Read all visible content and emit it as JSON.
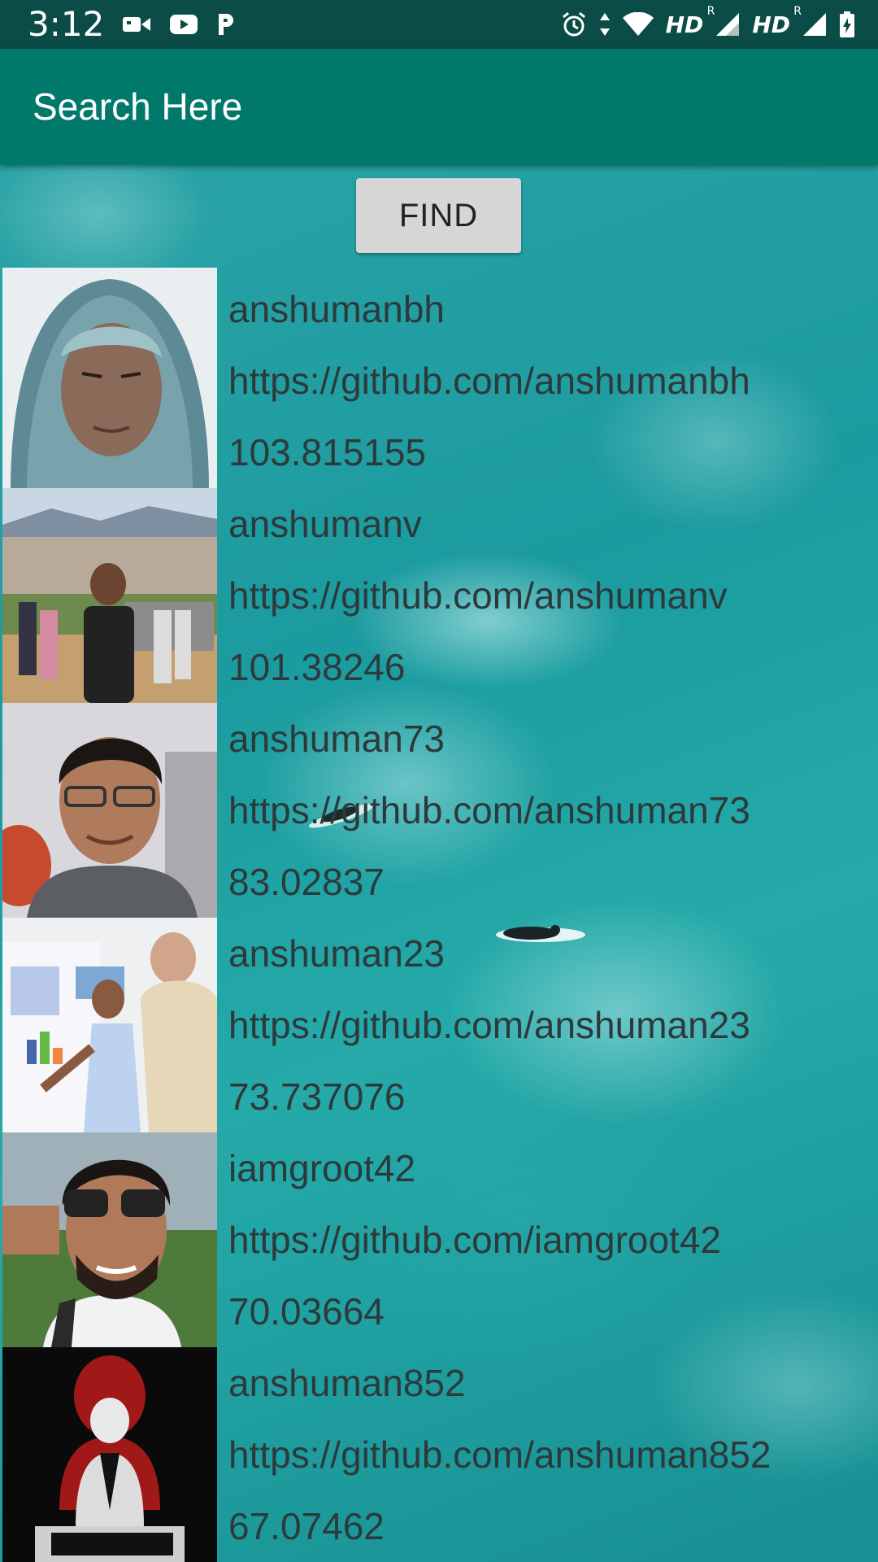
{
  "status_bar": {
    "time": "3:12",
    "left_icons": [
      "video-camera-icon",
      "youtube-icon",
      "pandora-icon"
    ],
    "right_icons": [
      "alarm-icon",
      "data-arrows-icon",
      "wifi-icon",
      "signal-icon",
      "signal-icon",
      "battery-icon"
    ],
    "hd_label_1": "HD",
    "hd_label_2": "HD",
    "roaming_mark": "R"
  },
  "app_bar": {
    "title": "Search Here"
  },
  "find_button": {
    "label": "FIND"
  },
  "results": [
    {
      "username": "anshumanbh",
      "url": "https://github.com/anshumanbh",
      "score": "103.815155"
    },
    {
      "username": "anshumanv",
      "url": "https://github.com/anshumanv",
      "score": "101.38246"
    },
    {
      "username": "anshuman73",
      "url": "https://github.com/anshuman73",
      "score": "83.02837"
    },
    {
      "username": "anshuman23",
      "url": "https://github.com/anshuman23",
      "score": "73.737076"
    },
    {
      "username": "iamgroot42",
      "url": "https://github.com/iamgroot42",
      "score": "70.03664"
    },
    {
      "username": "anshuman852",
      "url": "https://github.com/anshuman852",
      "score": "67.07462"
    }
  ],
  "colors": {
    "status_bar": "#0b4d46",
    "app_bar": "#00796b",
    "row_text": "#2d3a3c",
    "button": "#d6d6d6"
  }
}
